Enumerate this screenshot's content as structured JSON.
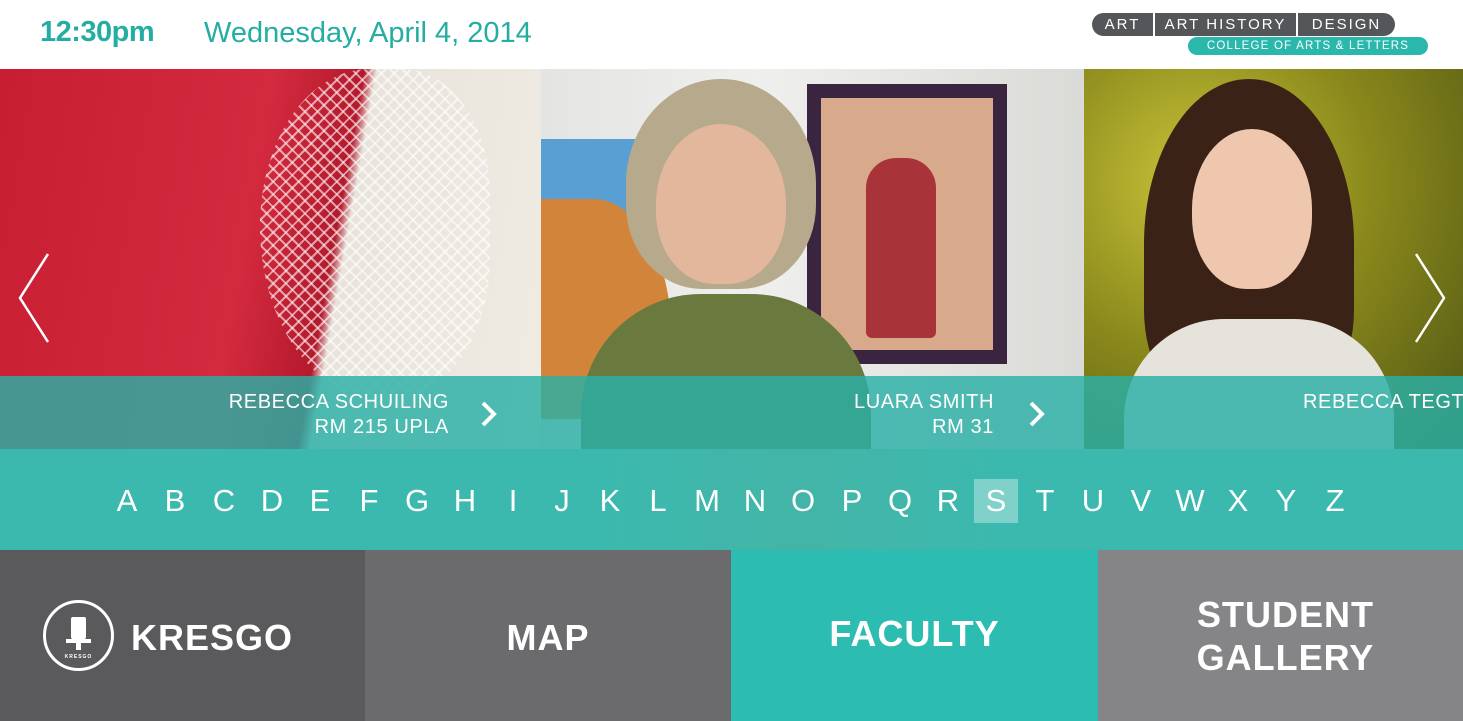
{
  "header": {
    "time": "12:30pm",
    "date": "Wednesday, April 4, 2014",
    "departments": [
      "ART",
      "ART HISTORY",
      "DESIGN"
    ],
    "college": "COLLEGE OF ARTS & LETTERS"
  },
  "carousel": {
    "slides": [
      {
        "name": "REBECCA SCHUILING",
        "room": "RM 215 UPLA"
      },
      {
        "name": "LUARA SMITH",
        "room": "RM 31"
      },
      {
        "name": "REBECCA TEGT"
      }
    ]
  },
  "alphabet": {
    "letters": [
      "A",
      "B",
      "C",
      "D",
      "E",
      "F",
      "G",
      "H",
      "I",
      "J",
      "K",
      "L",
      "M",
      "N",
      "O",
      "P",
      "Q",
      "R",
      "S",
      "T",
      "U",
      "V",
      "W",
      "X",
      "Y",
      "Z"
    ],
    "selected": "S"
  },
  "tiles": {
    "kresgo": "KRESGO",
    "kresgo_icon_text": "KRESGO",
    "map": "MAP",
    "faculty": "FACULTY",
    "gallery_line1": "STUDENT",
    "gallery_line2": "GALLERY"
  },
  "colors": {
    "accent": "#2cbcb1",
    "caption_overlay": "#29b0a6",
    "dark_tile": "#5a5a5c"
  },
  "icons": {
    "prev": "chevron-left-icon",
    "next": "chevron-right-icon",
    "caption_arrow": "chevron-right-icon",
    "kresgo": "kresgo-logo-icon"
  }
}
